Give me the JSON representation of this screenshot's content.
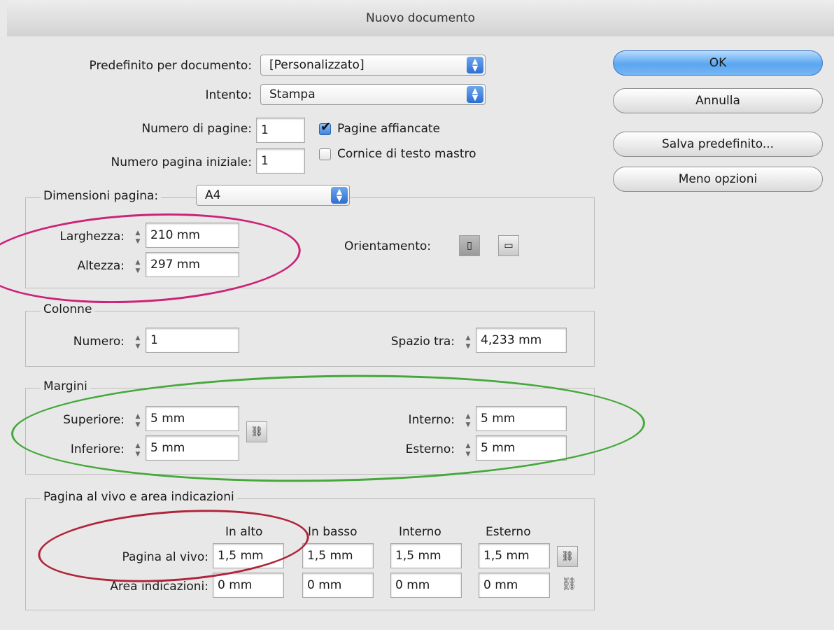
{
  "window": {
    "title": "Nuovo documento"
  },
  "buttons": {
    "ok": "OK",
    "cancel": "Annulla",
    "save_preset": "Salva predefinito...",
    "fewer_options": "Meno opzioni"
  },
  "top": {
    "preset_label": "Predefinito per documento:",
    "preset_value": "[Personalizzato]",
    "intent_label": "Intento:",
    "intent_value": "Stampa",
    "num_pages_label": "Numero di pagine:",
    "num_pages_value": "1",
    "start_page_label": "Numero pagina iniziale:",
    "start_page_value": "1",
    "facing_pages_label": "Pagine affiancate",
    "facing_pages_checked": true,
    "master_text_frame_label": "Cornice di testo mastro",
    "master_text_frame_checked": false
  },
  "page_size": {
    "label": "Dimensioni pagina:",
    "value": "A4",
    "width_label": "Larghezza:",
    "width_value": "210 mm",
    "height_label": "Altezza:",
    "height_value": "297 mm",
    "orientation_label": "Orientamento:",
    "portrait_icon": "portrait-icon",
    "landscape_icon": "landscape-icon"
  },
  "columns": {
    "legend": "Colonne",
    "number_label": "Numero:",
    "number_value": "1",
    "gutter_label": "Spazio tra:",
    "gutter_value": "4,233 mm"
  },
  "margins": {
    "legend": "Margini",
    "top_label": "Superiore:",
    "top_value": "5 mm",
    "bottom_label": "Inferiore:",
    "bottom_value": "5 mm",
    "inside_label": "Interno:",
    "inside_value": "5 mm",
    "outside_label": "Esterno:",
    "outside_value": "5 mm",
    "link_icon": "chain-link-icon"
  },
  "bleed": {
    "legend": "Pagina al vivo e area indicazioni",
    "headers": [
      "In alto",
      "In basso",
      "Interno",
      "Esterno"
    ],
    "bleed_label": "Pagina al vivo:",
    "bleed_values": [
      "1,5 mm",
      "1,5 mm",
      "1,5 mm",
      "1,5 mm"
    ],
    "slug_label": "Area indicazioni:",
    "slug_values": [
      "0 mm",
      "0 mm",
      "0 mm",
      "0 mm"
    ]
  },
  "annotation_colors": {
    "page_size_ellipse": "#cc2277",
    "margins_ellipse": "#44a83a",
    "bleed_ellipse": "#b0243a"
  }
}
